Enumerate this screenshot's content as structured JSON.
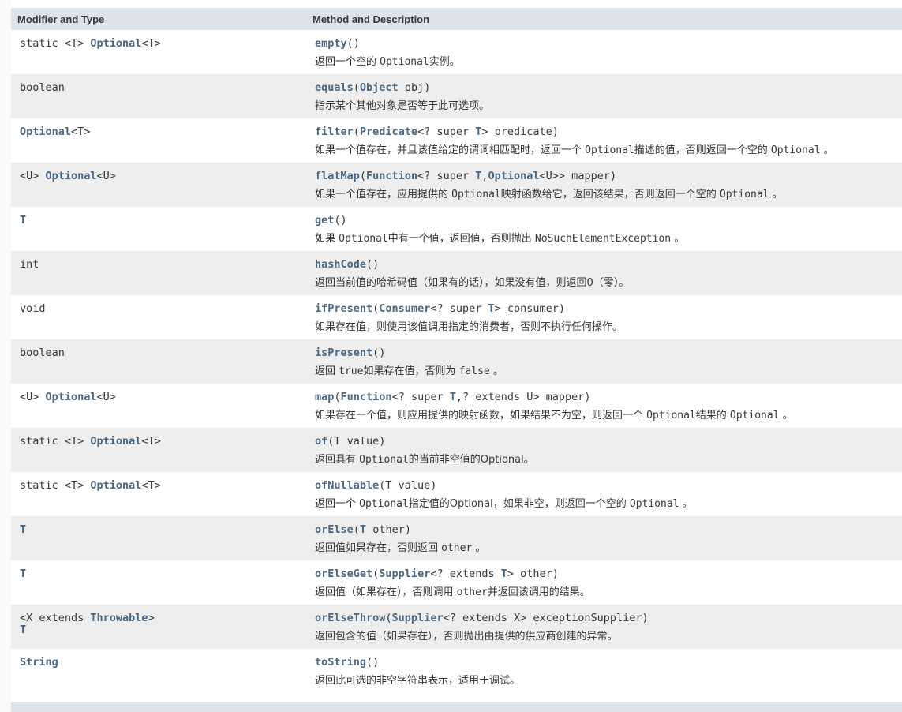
{
  "table": {
    "headers": {
      "modifier": "Modifier and Type",
      "method": "Method and Description"
    },
    "rows": [
      {
        "type": [
          {
            "t": "static <T> "
          },
          {
            "t": "Optional",
            "link": true
          },
          {
            "t": "<T>"
          }
        ],
        "method": [
          {
            "t": "empty",
            "link": true
          },
          {
            "t": "()"
          }
        ],
        "desc": [
          {
            "t": "返回一个空的 "
          },
          {
            "t": "Optional",
            "mono": true
          },
          {
            "t": "实例。"
          }
        ]
      },
      {
        "type": [
          {
            "t": "boolean"
          }
        ],
        "method": [
          {
            "t": "equals",
            "link": true
          },
          {
            "t": "("
          },
          {
            "t": "Object",
            "link": true
          },
          {
            "t": " obj)"
          }
        ],
        "desc": [
          {
            "t": "指示某个其他对象是否等于此可选项。"
          }
        ]
      },
      {
        "type": [
          {
            "t": "Optional",
            "link": true
          },
          {
            "t": "<T>"
          }
        ],
        "method": [
          {
            "t": "filter",
            "link": true
          },
          {
            "t": "("
          },
          {
            "t": "Predicate",
            "link": true
          },
          {
            "t": "<? super "
          },
          {
            "t": "T",
            "link": true
          },
          {
            "t": "> predicate)"
          }
        ],
        "desc": [
          {
            "t": "如果一个值存在，并且该值给定的谓词相匹配时，返回一个 "
          },
          {
            "t": "Optional",
            "mono": true
          },
          {
            "t": "描述的值，否则返回一个空的 "
          },
          {
            "t": "Optional",
            "mono": true
          },
          {
            "t": " 。"
          }
        ]
      },
      {
        "type": [
          {
            "t": "<U> "
          },
          {
            "t": "Optional",
            "link": true
          },
          {
            "t": "<U>"
          }
        ],
        "method": [
          {
            "t": "flatMap",
            "link": true
          },
          {
            "t": "("
          },
          {
            "t": "Function",
            "link": true
          },
          {
            "t": "<? super "
          },
          {
            "t": "T",
            "link": true
          },
          {
            "t": ","
          },
          {
            "t": "Optional",
            "link": true
          },
          {
            "t": "<U>> mapper)"
          }
        ],
        "desc": [
          {
            "t": "如果一个值存在，应用提供的 "
          },
          {
            "t": "Optional",
            "mono": true
          },
          {
            "t": "映射函数给它，返回该结果，否则返回一个空的 "
          },
          {
            "t": "Optional",
            "mono": true
          },
          {
            "t": " 。"
          }
        ]
      },
      {
        "type": [
          {
            "t": "T",
            "link": true
          }
        ],
        "method": [
          {
            "t": "get",
            "link": true
          },
          {
            "t": "()"
          }
        ],
        "desc": [
          {
            "t": "如果 "
          },
          {
            "t": "Optional",
            "mono": true
          },
          {
            "t": "中有一个值，返回值，否则抛出 "
          },
          {
            "t": "NoSuchElementException",
            "mono": true
          },
          {
            "t": " 。"
          }
        ]
      },
      {
        "type": [
          {
            "t": "int"
          }
        ],
        "method": [
          {
            "t": "hashCode",
            "link": true
          },
          {
            "t": "()"
          }
        ],
        "desc": [
          {
            "t": "返回当前值的哈希码值（如果有的话），如果没有值，则返回0（零）。"
          }
        ]
      },
      {
        "type": [
          {
            "t": "void"
          }
        ],
        "method": [
          {
            "t": "ifPresent",
            "link": true
          },
          {
            "t": "("
          },
          {
            "t": "Consumer",
            "link": true
          },
          {
            "t": "<? super "
          },
          {
            "t": "T",
            "link": true
          },
          {
            "t": "> consumer)"
          }
        ],
        "desc": [
          {
            "t": "如果存在值，则使用该值调用指定的消费者，否则不执行任何操作。"
          }
        ]
      },
      {
        "type": [
          {
            "t": "boolean"
          }
        ],
        "method": [
          {
            "t": "isPresent",
            "link": true
          },
          {
            "t": "()"
          }
        ],
        "desc": [
          {
            "t": "返回 "
          },
          {
            "t": "true",
            "mono": true
          },
          {
            "t": "如果存在值，否则为 "
          },
          {
            "t": "false",
            "mono": true
          },
          {
            "t": " 。"
          }
        ]
      },
      {
        "type": [
          {
            "t": "<U> "
          },
          {
            "t": "Optional",
            "link": true
          },
          {
            "t": "<U>"
          }
        ],
        "method": [
          {
            "t": "map",
            "link": true
          },
          {
            "t": "("
          },
          {
            "t": "Function",
            "link": true
          },
          {
            "t": "<? super "
          },
          {
            "t": "T",
            "link": true
          },
          {
            "t": ",? extends U> mapper)"
          }
        ],
        "desc": [
          {
            "t": "如果存在一个值，则应用提供的映射函数，如果结果不为空，则返回一个 "
          },
          {
            "t": "Optional",
            "mono": true
          },
          {
            "t": "结果的 "
          },
          {
            "t": "Optional",
            "mono": true
          },
          {
            "t": " 。"
          }
        ]
      },
      {
        "type": [
          {
            "t": "static <T> "
          },
          {
            "t": "Optional",
            "link": true
          },
          {
            "t": "<T>"
          }
        ],
        "method": [
          {
            "t": "of",
            "link": true
          },
          {
            "t": "(T value)"
          }
        ],
        "desc": [
          {
            "t": "返回具有 "
          },
          {
            "t": "Optional",
            "mono": true
          },
          {
            "t": "的当前非空值的Optional。"
          }
        ]
      },
      {
        "type": [
          {
            "t": "static <T> "
          },
          {
            "t": "Optional",
            "link": true
          },
          {
            "t": "<T>"
          }
        ],
        "method": [
          {
            "t": "ofNullable",
            "link": true
          },
          {
            "t": "(T value)"
          }
        ],
        "desc": [
          {
            "t": "返回一个 "
          },
          {
            "t": "Optional",
            "mono": true
          },
          {
            "t": "指定值的Optional，如果非空，则返回一个空的 "
          },
          {
            "t": "Optional",
            "mono": true
          },
          {
            "t": " 。"
          }
        ]
      },
      {
        "type": [
          {
            "t": "T",
            "link": true
          }
        ],
        "method": [
          {
            "t": "orElse",
            "link": true
          },
          {
            "t": "("
          },
          {
            "t": "T",
            "link": true
          },
          {
            "t": " other)"
          }
        ],
        "desc": [
          {
            "t": "返回值如果存在，否则返回 "
          },
          {
            "t": "other",
            "mono": true
          },
          {
            "t": " 。"
          }
        ]
      },
      {
        "type": [
          {
            "t": "T",
            "link": true
          }
        ],
        "method": [
          {
            "t": "orElseGet",
            "link": true
          },
          {
            "t": "("
          },
          {
            "t": "Supplier",
            "link": true
          },
          {
            "t": "<? extends "
          },
          {
            "t": "T",
            "link": true
          },
          {
            "t": "> other)"
          }
        ],
        "desc": [
          {
            "t": "返回值（如果存在），否则调用 "
          },
          {
            "t": "other",
            "mono": true
          },
          {
            "t": "并返回该调用的结果。"
          }
        ]
      },
      {
        "type": [
          {
            "t": "<X extends "
          },
          {
            "t": "Throwable",
            "link": true
          },
          {
            "t": ">"
          },
          {
            "br": true
          },
          {
            "t": "T",
            "link": true
          }
        ],
        "method": [
          {
            "t": "orElseThrow",
            "link": true
          },
          {
            "t": "("
          },
          {
            "t": "Supplier",
            "link": true
          },
          {
            "t": "<? extends X> exceptionSupplier)"
          }
        ],
        "desc": [
          {
            "t": "返回包含的值（如果存在），否则抛出由提供的供应商创建的异常。"
          }
        ]
      },
      {
        "type": [
          {
            "t": "String",
            "link": true
          }
        ],
        "method": [
          {
            "t": "toString",
            "link": true
          },
          {
            "t": "()"
          }
        ],
        "desc": [
          {
            "t": "返回此可选的非空字符串表示，适用于调试。"
          }
        ]
      }
    ]
  }
}
